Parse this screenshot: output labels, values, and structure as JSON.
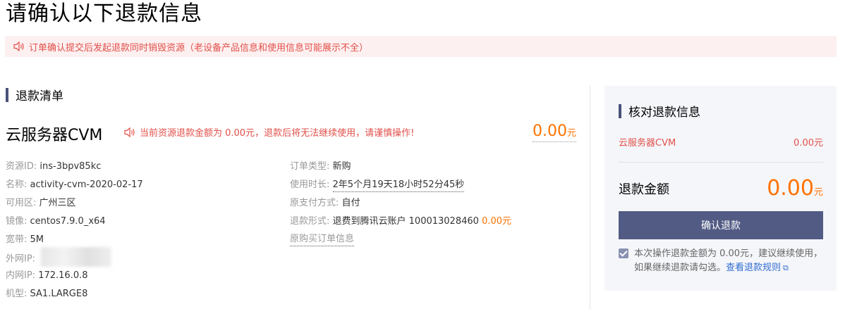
{
  "page": {
    "title": "请确认以下退款信息",
    "notice": "订单确认提交后发起退款同时销毁资源（老设备产品信息和使用信息可能展示不全）"
  },
  "refund_list": {
    "heading": "退款清单",
    "product_name": "云服务器CVM",
    "warning": "当前资源退款金额为 0.00元，退款后将无法继续使用，请谨慎操作!",
    "price_amount": "0.00",
    "price_unit": "元"
  },
  "resource_info": {
    "left": [
      {
        "key": "资源ID:",
        "value": "ins-3bpv85kc"
      },
      {
        "key": "名称:",
        "value": "activity-cvm-2020-02-17"
      },
      {
        "key": "可用区:",
        "value": "广州三区"
      },
      {
        "key": "镜像:",
        "value": "centos7.9.0_x64"
      },
      {
        "key": "宽带:",
        "value": "5M"
      },
      {
        "key": "外网IP:",
        "value": ""
      },
      {
        "key": "内网IP:",
        "value": "172.16.0.8"
      },
      {
        "key": "机型:",
        "value": "SA1.LARGE8"
      }
    ],
    "right": {
      "order_type_key": "订单类型:",
      "order_type_value": "新购",
      "duration_key": "使用时长:",
      "duration_value": "2年5个月19天18小时52分45秒",
      "payment_key": "原支付方式:",
      "payment_value": "自付",
      "refund_form_key": "退款形式:",
      "refund_form_value": "退费到腾讯云账户 100013028460",
      "refund_form_amount": "0.00元",
      "original_order_link": "原购买订单信息"
    }
  },
  "summary": {
    "heading": "核对退款信息",
    "item_name": "云服务器CVM",
    "item_amount": "0.00元",
    "total_label": "退款金额",
    "total_amount": "0.00",
    "total_unit": "元",
    "confirm_button": "确认退款",
    "agree_text": "本次操作退款金额为 0.00元，建议继续使用，如果继续退款请勾选。",
    "rules_link": "查看退款规则"
  },
  "colors": {
    "accent": "#4a5279",
    "button": "#525b84",
    "warning": "#e1504a",
    "price": "#ff7200",
    "link": "#2e6cd1"
  },
  "icons": [
    "speaker-icon",
    "checkbox-checked-icon",
    "external-link-icon"
  ]
}
